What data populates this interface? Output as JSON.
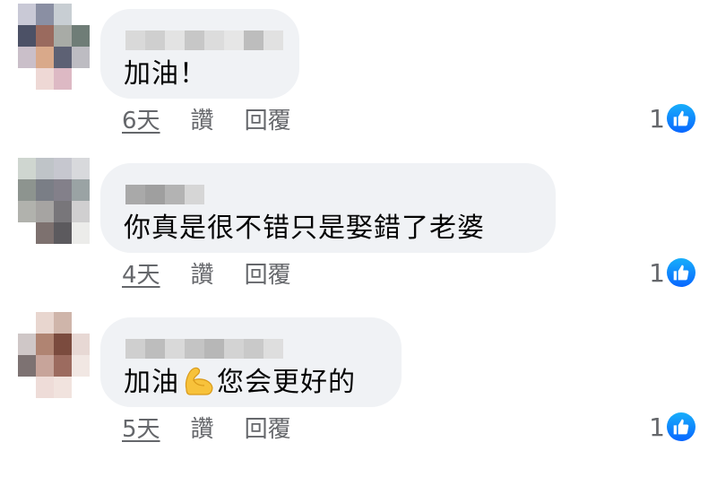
{
  "comments": [
    {
      "text": "加油！",
      "time": "6天",
      "like_label": "讚",
      "reply_label": "回覆",
      "likes": "1",
      "avatar_colors": [
        "#c9c9d6",
        "#8a8fa3",
        "#c8ced3",
        "#ffffff",
        "#4c5166",
        "#9a6a5e",
        "#a8aba6",
        "#6f7d77",
        "#cabfc9",
        "#d9a98a",
        "#5d6174",
        "#bdbcc2",
        "#ffffff",
        "#eed8d5",
        "#ddb9c4",
        "#ffffff"
      ]
    },
    {
      "text": "你真是很不错只是娶錯了老婆",
      "time": "4天",
      "like_label": "讚",
      "reply_label": "回覆",
      "likes": "1",
      "avatar_colors": [
        "#cfd6d0",
        "#bfc4c8",
        "#c6c7cf",
        "#d8d9dc",
        "#8d948f",
        "#7a7e86",
        "#83808a",
        "#9aa3a4",
        "#b1b2ad",
        "#a6a4a2",
        "#78767a",
        "#d0cfd0",
        "#ffffff",
        "#7d716f",
        "#5c5a5e",
        "#ececea"
      ]
    },
    {
      "text_before": "加油",
      "text_after": "您会更好的",
      "time": "5天",
      "like_label": "讚",
      "reply_label": "回覆",
      "likes": "1",
      "avatar_colors": [
        "#ffffff",
        "#e8d6cf",
        "#cfb5aa",
        "#ffffff",
        "#cfc7c7",
        "#b08472",
        "#7b4b3e",
        "#e7d8d4",
        "#7d7272",
        "#c7a49a",
        "#9c6b5f",
        "#f1e7e3",
        "#ffffff",
        "#eedcd8",
        "#f1e3de",
        "#ffffff"
      ]
    }
  ],
  "icons": {
    "like": "thumbs-up-icon",
    "emoji": "flexed-biceps-emoji"
  },
  "colors": {
    "bubble": "#f0f2f5",
    "meta_text": "#65676b",
    "like_blue": "#0866ff"
  }
}
